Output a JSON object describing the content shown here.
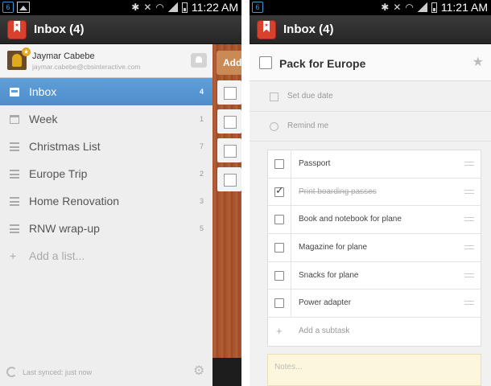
{
  "left_screen": {
    "status": {
      "badge": "6",
      "time": "11:22 AM"
    },
    "app_title": "Inbox (4)",
    "account": {
      "name": "Jaymar Cabebe",
      "email": "jaymar.cabebe@cbsinteractive.com"
    },
    "lists": [
      {
        "label": "Inbox",
        "count": "4",
        "icon": "inbox-icon",
        "active": true
      },
      {
        "label": "Week",
        "count": "1",
        "icon": "calendar-icon",
        "active": false
      },
      {
        "label": "Christmas List",
        "count": "7",
        "icon": "list-icon",
        "active": false
      },
      {
        "label": "Europe Trip",
        "count": "2",
        "icon": "list-icon",
        "active": false
      },
      {
        "label": "Home Renovation",
        "count": "3",
        "icon": "list-icon",
        "active": false
      },
      {
        "label": "RNW wrap-up",
        "count": "5",
        "icon": "list-icon",
        "active": false
      }
    ],
    "add_list_label": "Add a list...",
    "sync_text": "Last synced: just now",
    "peek_add_label": "Add"
  },
  "right_screen": {
    "status": {
      "badge": "6",
      "time": "11:21 AM"
    },
    "app_title": "Inbox (4)",
    "task": {
      "title": "Pack for Europe",
      "starred": false
    },
    "due_date_label": "Set due date",
    "reminder_label": "Remind me",
    "subtasks": [
      {
        "label": "Passport",
        "done": false
      },
      {
        "label": "Print boarding passes",
        "done": true
      },
      {
        "label": "Book and notebook for plane",
        "done": false
      },
      {
        "label": "Magazine for plane",
        "done": false
      },
      {
        "label": "Snacks for plane",
        "done": false
      },
      {
        "label": "Power adapter",
        "done": false
      }
    ],
    "add_subtask_label": "Add a subtask",
    "notes_placeholder": "Notes..."
  },
  "colors": {
    "accent_blue": "#5f9fd8",
    "brand_red": "#d9412f",
    "wood": "#a8522a",
    "notes_bg": "#fcf7dc"
  }
}
